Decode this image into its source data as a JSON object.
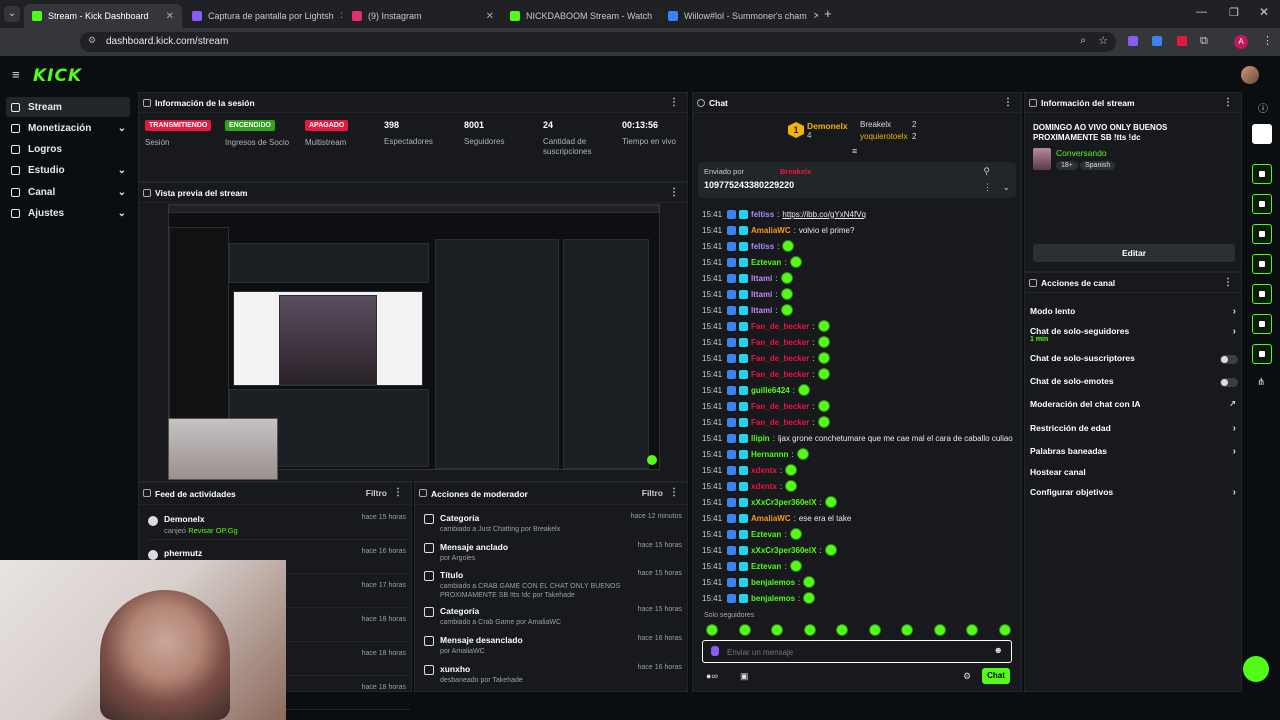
{
  "browser": {
    "tabs": [
      {
        "label": "Stream - Kick Dashboard",
        "color": "#53fc18",
        "active": true
      },
      {
        "label": "Captura de pantalla por Lightsh",
        "color": "#8a5cf6"
      },
      {
        "label": "(9) Instagram",
        "color": "#e1306c"
      },
      {
        "label": "NICKDABOOM Stream - Watch",
        "color": "#53fc18"
      },
      {
        "label": "Wiilow#lol - Summoner's cham",
        "color": "#3b82f6"
      }
    ],
    "url": "dashboard.kick.com/stream",
    "profile_initial": "A"
  },
  "kick": {
    "logo": "KICK",
    "sidebar": [
      {
        "label": "Stream",
        "active": true,
        "chevron": false
      },
      {
        "label": "Monetización",
        "chevron": true
      },
      {
        "label": "Logros",
        "chevron": false
      },
      {
        "label": "Estudio",
        "chevron": true
      },
      {
        "label": "Canal",
        "chevron": true
      },
      {
        "label": "Ajustes",
        "chevron": true
      }
    ]
  },
  "session": {
    "title": "Información de la sesión",
    "stats": [
      {
        "badge": "TRANSMITIENDO",
        "badge_color": "#e8173d",
        "label": "Sesión"
      },
      {
        "badge": "ENCENDIDO",
        "badge_color": "#2fa31a",
        "label": "Ingresos de Socio"
      },
      {
        "badge": "APAGADO",
        "badge_color": "#e8173d",
        "label": "Multistream"
      },
      {
        "value": "398",
        "label": "Espectadores"
      },
      {
        "value": "8001",
        "label": "Seguidores"
      },
      {
        "value": "24",
        "label": "Cantidad de suscripciones"
      },
      {
        "value": "00:13:56",
        "label": "Tiempo en vivo"
      }
    ]
  },
  "preview": {
    "title": "Vista previa del stream"
  },
  "feed": {
    "title": "Feed de actividades",
    "filter": "Filtro",
    "items": [
      {
        "name": "Demonelx",
        "sub_prefix": "canjeó ",
        "sub_link": "Revisar OP.Gg",
        "time": "hace 15 horas"
      },
      {
        "name": "phermutz",
        "sub_prefix": "canjeó ",
        "sub_link": "Revisar OP.Gg",
        "time": "hace 16 horas"
      },
      {
        "name": "",
        "sub_prefix": "",
        "sub_link": "",
        "time": "hace 17 horas"
      },
      {
        "name": "",
        "sub_prefix": "",
        "sub_link": "",
        "time": "hace 18 horas"
      },
      {
        "name": "",
        "sub_prefix": "",
        "sub_link": "",
        "time": "hace 18 horas"
      },
      {
        "name": "",
        "sub_prefix": "",
        "sub_link": "",
        "time": "hace 18 horas"
      }
    ]
  },
  "mod": {
    "title": "Acciones de moderador",
    "filter": "Filtro",
    "items": [
      {
        "title": "Categoría",
        "sub": "cambiado a Just Chatting por Breakelx",
        "time": "hace 12 minutos"
      },
      {
        "title": "Mensaje anclado",
        "sub": "por Argoles",
        "time": "hace 15 horas"
      },
      {
        "title": "Título",
        "sub": "cambiado a CRAB GAME CON EL CHAT ONLY BUENOS PROXIMAMENTE SB !tts !dc por Takehade",
        "time": "hace 15 horas"
      },
      {
        "title": "Categoría",
        "sub": "cambiado a Crab Game por AmaliaWC",
        "time": "hace 15 horas"
      },
      {
        "title": "Mensaje desanclado",
        "sub": "por AmaliaWC",
        "time": "hace 16 horas"
      },
      {
        "title": "xunxho",
        "sub": "desbaneado por Takehade",
        "time": "hace 16 horas"
      }
    ]
  },
  "chat": {
    "title": "Chat",
    "top_gifters": [
      {
        "name": "Demonelx",
        "count": "4"
      },
      {
        "name": "Breakelx",
        "count": "2"
      },
      {
        "name": "yoquierotoelx",
        "count": "2"
      }
    ],
    "rank_number": "1",
    "pinned": {
      "label": "Enviado por",
      "user": "Breakelx",
      "text": "109775243380229220"
    },
    "messages": [
      {
        "time": "15:41",
        "user": "feltiss",
        "color": "#a78bfa",
        "text": "https://ibb.co/gYxN4fVq"
      },
      {
        "time": "15:41",
        "user": "AmaliaWC",
        "color": "#f59e0b",
        "text": "volvio el prime?"
      },
      {
        "time": "15:41",
        "user": "feltiss",
        "color": "#a78bfa",
        "text": ""
      },
      {
        "time": "15:41",
        "user": "Eztevan",
        "color": "#53fc18",
        "text": ""
      },
      {
        "time": "15:41",
        "user": "Ittami",
        "color": "#c084fc",
        "text": ""
      },
      {
        "time": "15:41",
        "user": "Ittami",
        "color": "#c084fc",
        "text": ""
      },
      {
        "time": "15:41",
        "user": "Ittami",
        "color": "#c084fc",
        "text": ""
      },
      {
        "time": "15:41",
        "user": "Fan_de_becker",
        "color": "#e8173d",
        "text": ""
      },
      {
        "time": "15:41",
        "user": "Fan_de_becker",
        "color": "#e8173d",
        "text": ""
      },
      {
        "time": "15:41",
        "user": "Fan_de_becker",
        "color": "#e8173d",
        "text": ""
      },
      {
        "time": "15:41",
        "user": "Fan_de_becker",
        "color": "#e8173d",
        "text": ""
      },
      {
        "time": "15:41",
        "user": "guille6424",
        "color": "#53fc18",
        "text": ""
      },
      {
        "time": "15:41",
        "user": "Fan_de_becker",
        "color": "#e8173d",
        "text": ""
      },
      {
        "time": "15:41",
        "user": "Fan_de_becker",
        "color": "#e8173d",
        "text": ""
      },
      {
        "time": "15:41",
        "user": "llipin",
        "color": "#53fc18",
        "text": "ljax grone conchetumare que me cae mal el cara de caballo culiao"
      },
      {
        "time": "15:41",
        "user": "Hernannn",
        "color": "#53fc18",
        "text": ""
      },
      {
        "time": "15:41",
        "user": "xdxntx",
        "color": "#e8173d",
        "text": ""
      },
      {
        "time": "15:41",
        "user": "xdxntx",
        "color": "#e8173d",
        "text": ""
      },
      {
        "time": "15:41",
        "user": "xXxCr3per360elX",
        "color": "#53fc18",
        "text": ""
      },
      {
        "time": "15:41",
        "user": "AmaliaWC",
        "color": "#f59e0b",
        "text": "ese era el take"
      },
      {
        "time": "15:41",
        "user": "Eztevan",
        "color": "#53fc18",
        "text": ""
      },
      {
        "time": "15:41",
        "user": "xXxCr3per360elX",
        "color": "#53fc18",
        "text": ""
      },
      {
        "time": "15:41",
        "user": "Eztevan",
        "color": "#53fc18",
        "text": ""
      },
      {
        "time": "15:41",
        "user": "benjalemos",
        "color": "#53fc18",
        "text": ""
      },
      {
        "time": "15:41",
        "user": "benjalemos",
        "color": "#53fc18",
        "text": ""
      }
    ],
    "followers_only": "Solo seguidores",
    "input_placeholder": "Enviar un mensaje",
    "send_label": "Chat",
    "infinity": "∞"
  },
  "stream_info": {
    "title": "Información del stream",
    "stream_title": "DOMINGO AO VIVO ONLY BUENOS PROXIMAMENTE SB !tts !dc",
    "category": "Conversando",
    "tags": [
      "18+",
      "Spanish"
    ],
    "edit_label": "Editar"
  },
  "channel_actions": {
    "title": "Acciones de canal",
    "items": [
      {
        "label": "Modo lento",
        "control": "arrow"
      },
      {
        "label": "Chat de solo-seguidores",
        "sub": "1 min",
        "control": "arrow"
      },
      {
        "label": "Chat de solo-suscriptores",
        "control": "toggle"
      },
      {
        "label": "Chat de solo-emotes",
        "control": "toggle"
      },
      {
        "label": "Moderación del chat con IA",
        "control": "external"
      },
      {
        "label": "Restricción de edad",
        "control": "arrow"
      },
      {
        "label": "Palabras baneadas",
        "control": "arrow"
      },
      {
        "label": "Hostear canal",
        "control": "none"
      },
      {
        "label": "Configurar objetivos",
        "control": "arrow"
      }
    ]
  }
}
